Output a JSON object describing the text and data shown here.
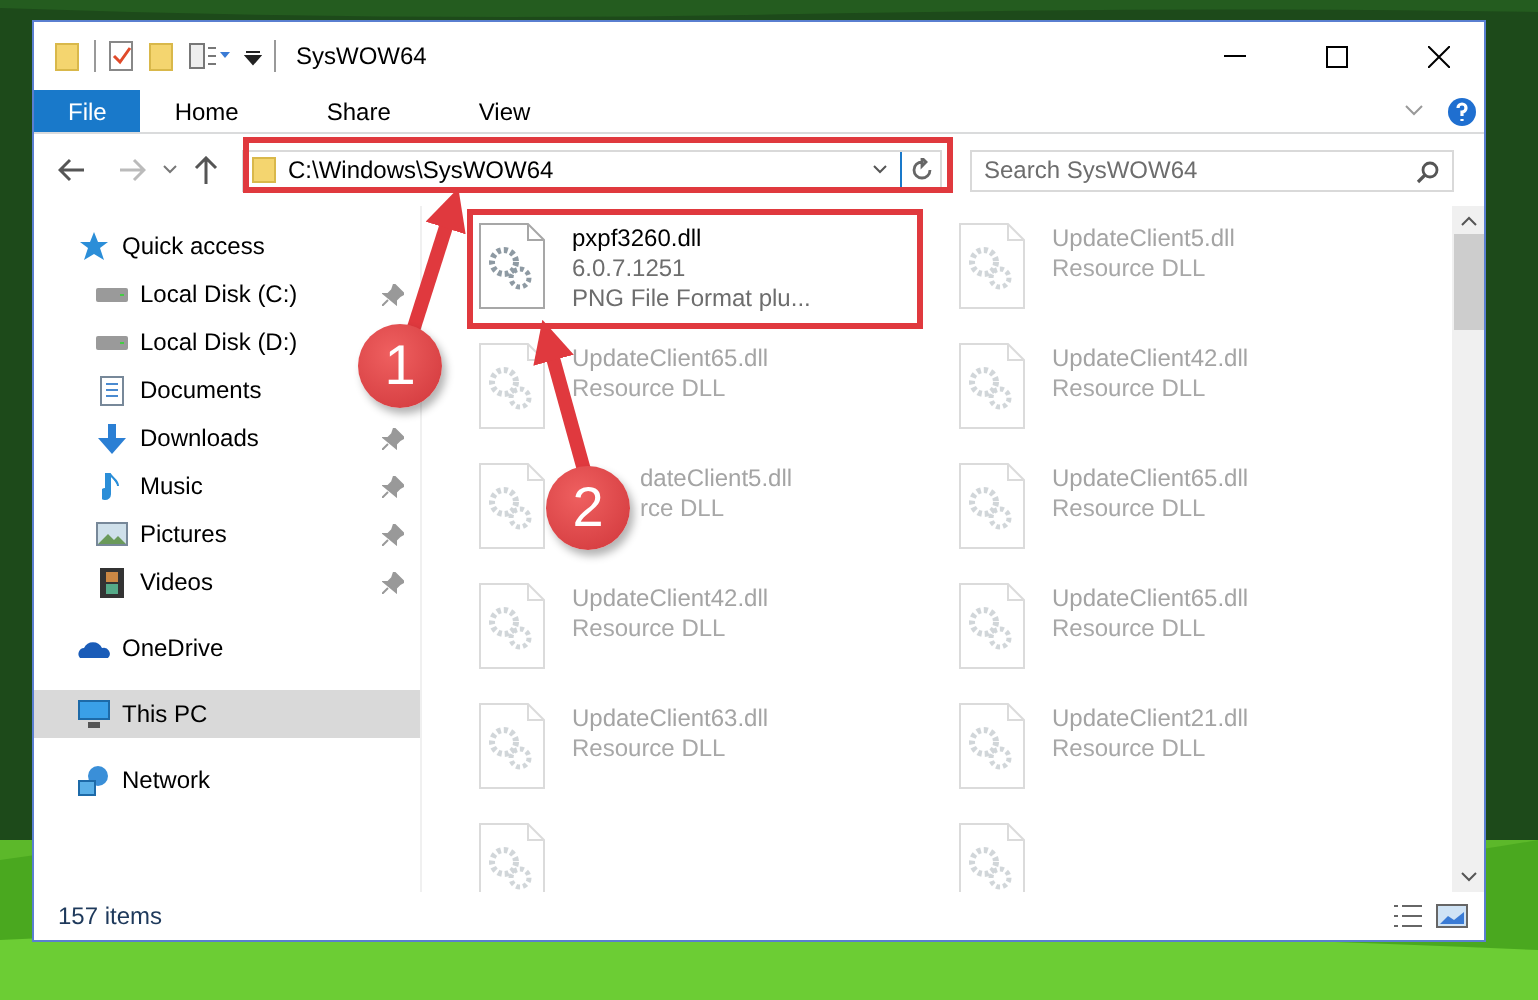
{
  "window": {
    "title": "SysWOW64"
  },
  "ribbon": {
    "tabs": [
      {
        "label": "File",
        "selected": true
      },
      {
        "label": "Home",
        "selected": false
      },
      {
        "label": "Share",
        "selected": false
      },
      {
        "label": "View",
        "selected": false
      }
    ]
  },
  "address": {
    "path": "C:\\Windows\\SysWOW64"
  },
  "search": {
    "placeholder": "Search SysWOW64"
  },
  "sidebar": {
    "items": [
      {
        "label": "Quick access",
        "selected": false,
        "children": [
          {
            "label": "Local Disk (C:)",
            "pinned": true
          },
          {
            "label": "Local Disk (D:)"
          },
          {
            "label": "Documents"
          },
          {
            "label": "Downloads",
            "pinned": true
          },
          {
            "label": "Music",
            "pinned": true
          },
          {
            "label": "Pictures",
            "pinned": true
          },
          {
            "label": "Videos",
            "pinned": true
          }
        ]
      },
      {
        "label": "OneDrive",
        "selected": false
      },
      {
        "label": "This PC",
        "selected": true
      },
      {
        "label": "Network",
        "selected": false
      }
    ]
  },
  "files": [
    {
      "kind": "file",
      "name": "pxpf3260.dll",
      "lines": [
        "6.0.7.1251",
        "PNG File Format plu..."
      ],
      "dimmed": false
    },
    {
      "kind": "file",
      "name": "UpdateClient5.dll",
      "lines": [
        "Resource DLL"
      ],
      "dimmed": true
    },
    {
      "kind": "file",
      "name": "UpdateClient65.dll",
      "lines": [
        "Resource DLL"
      ],
      "dimmed": true
    },
    {
      "kind": "file",
      "name": "UpdateClient42.dll",
      "lines": [
        "Resource DLL"
      ],
      "dimmed": true
    },
    {
      "kind": "covered",
      "name": "dateClient5.dll",
      "lines": [
        "rce DLL"
      ],
      "dimmed": true
    },
    {
      "kind": "file",
      "name": "UpdateClient65.dll",
      "lines": [
        "Resource DLL"
      ],
      "dimmed": true
    },
    {
      "kind": "file",
      "name": "UpdateClient42.dll",
      "lines": [
        "Resource DLL"
      ],
      "dimmed": true
    },
    {
      "kind": "file",
      "name": "UpdateClient65.dll",
      "lines": [
        "Resource DLL"
      ],
      "dimmed": true
    },
    {
      "kind": "file",
      "name": "UpdateClient63.dll",
      "lines": [
        "Resource DLL"
      ],
      "dimmed": true
    },
    {
      "kind": "file",
      "name": "UpdateClient21.dll",
      "lines": [
        "Resource DLL"
      ],
      "dimmed": true
    },
    {
      "kind": "partial",
      "dimmed": true
    },
    {
      "kind": "partial",
      "dimmed": true
    }
  ],
  "status_bar": {
    "count": "157 items"
  },
  "annotations": [
    {
      "label": "1"
    },
    {
      "label": "2"
    }
  ]
}
